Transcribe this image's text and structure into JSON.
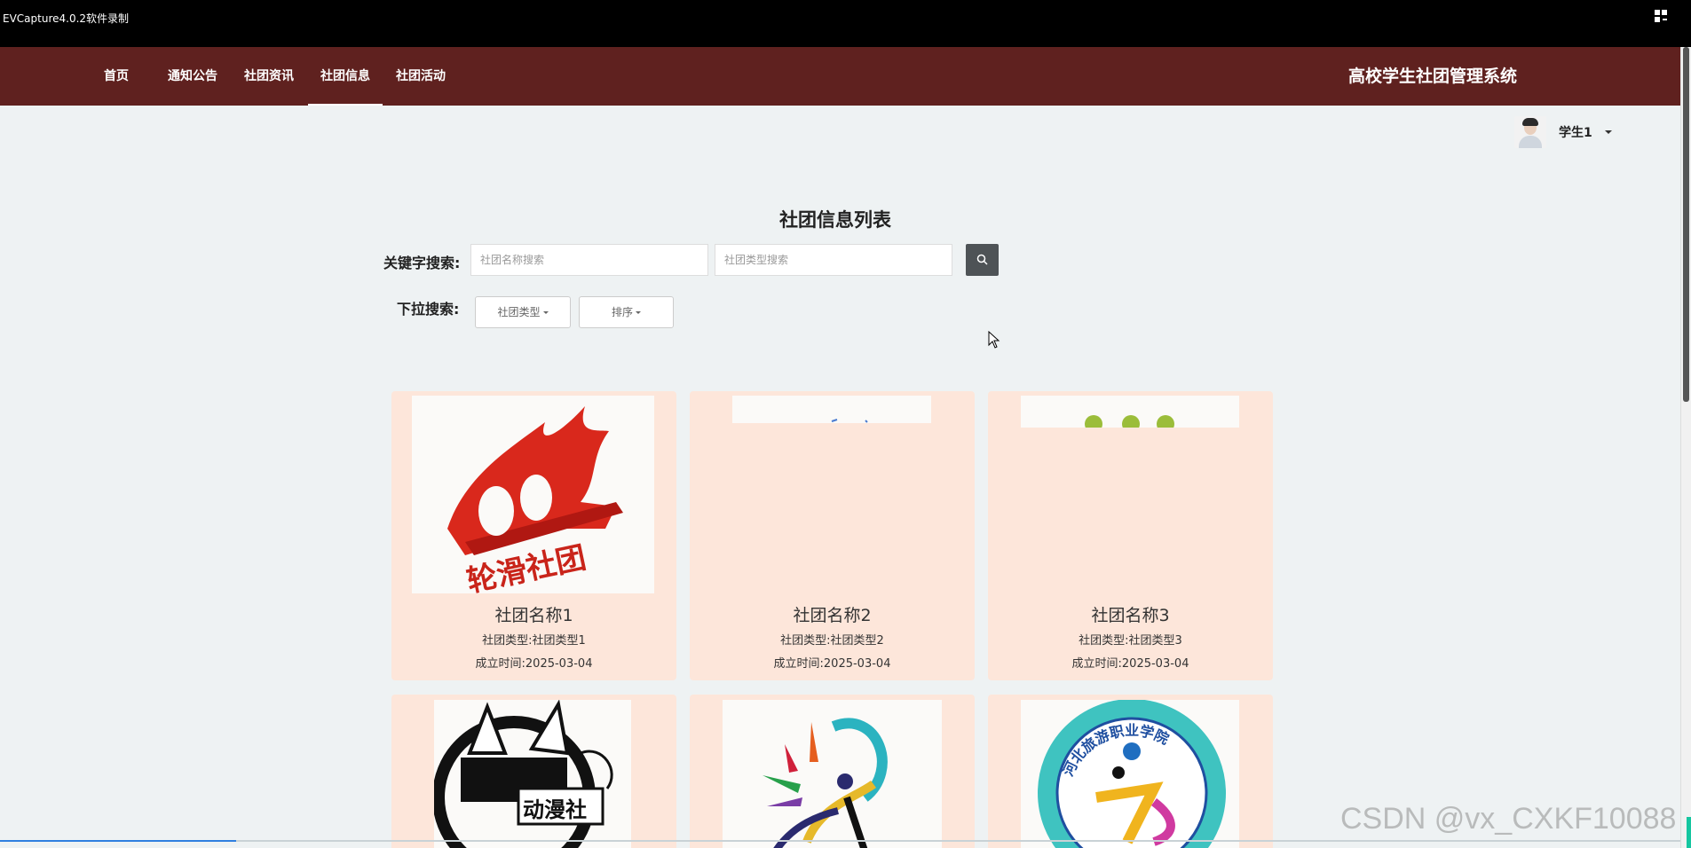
{
  "capture": {
    "title": "EVCapture4.0.2软件录制"
  },
  "nav": {
    "items": [
      {
        "label": "首页"
      },
      {
        "label": "通知公告"
      },
      {
        "label": "社团资讯"
      },
      {
        "label": "社团信息",
        "active": true
      },
      {
        "label": "社团活动"
      }
    ],
    "site_title": "高校学生社团管理系统",
    "bg_color": "#5f211f"
  },
  "user": {
    "name": "学生1"
  },
  "page": {
    "title": "社团信息列表"
  },
  "search": {
    "keyword_label": "关键字搜索:",
    "name_placeholder": "社团名称搜索",
    "type_placeholder": "社团类型搜索",
    "dropdown_label": "下拉搜索:",
    "type_dropdown": "社团类型",
    "sort_dropdown": "排序"
  },
  "cards": [
    {
      "name": "社团名称1",
      "type": "社团类型:社团类型1",
      "date": "成立时间:2025-03-04",
      "logo_text": "轮滑社团"
    },
    {
      "name": "社团名称2",
      "type": "社团类型:社团类型2",
      "date": "成立时间:2025-03-04"
    },
    {
      "name": "社团名称3",
      "type": "社团类型:社团类型3",
      "date": "成立时间:2025-03-04"
    },
    {
      "logo_text": "动漫社"
    },
    {},
    {
      "logo_text": "河北旅游职业学院"
    }
  ],
  "watermark": "CSDN @vx_CXKF10088"
}
